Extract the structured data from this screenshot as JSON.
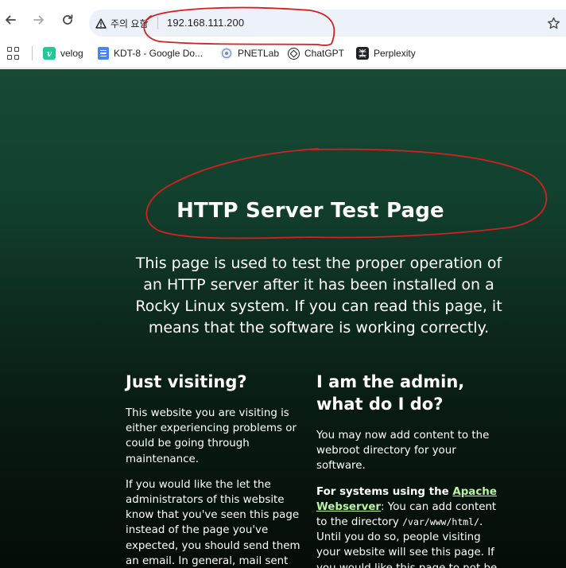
{
  "browser": {
    "security_label": "주의 요함",
    "url": "192.168.111.200",
    "icons": {
      "back": "arrow-left-icon",
      "forward": "arrow-right-icon",
      "reload": "reload-icon",
      "warning": "warning-triangle-icon",
      "bookmark": "star-icon",
      "apps": "apps-grid-icon"
    }
  },
  "bookmarks": [
    {
      "label": "velog",
      "icon": "velog-icon",
      "glyph": "v"
    },
    {
      "label": "KDT-8 - Google Do...",
      "icon": "google-docs-icon"
    },
    {
      "label": "PNETLab",
      "icon": "pnetlab-icon"
    },
    {
      "label": "ChatGPT",
      "icon": "chatgpt-icon"
    },
    {
      "label": "Perplexity",
      "icon": "perplexity-icon"
    }
  ],
  "page": {
    "title": "HTTP Server Test Page",
    "intro": "This page is used to test the proper operation of an HTTP server after it has been installed on a Rocky Linux system. If you can read this page, it means that the software is working correctly.",
    "left": {
      "heading": "Just visiting?",
      "p1": "This website you are visiting is either experiencing problems or could be going through maintenance.",
      "p2": "If you would like the let the administrators of this website know that you've seen this page instead of the page you've expected, you should send them an email. In general, mail sent to"
    },
    "right": {
      "heading": "I am the admin, what do I do?",
      "p1": "You may now add content to the webroot directory for your software.",
      "p2_bold": "For systems using the ",
      "p2_link": "Apache Webserver",
      "p2_after": ": You can add content to the directory ",
      "p2_code": "/var/www/html/",
      "p2_rest": ". Until you do so, people visiting your website will see this page. If you would like this page to not be"
    }
  },
  "colors": {
    "page_top": "#164a35",
    "page_bottom": "#050c08",
    "link": "#b8f5a0",
    "annotation": "#d42020",
    "omnibox": "#edf2fa"
  }
}
